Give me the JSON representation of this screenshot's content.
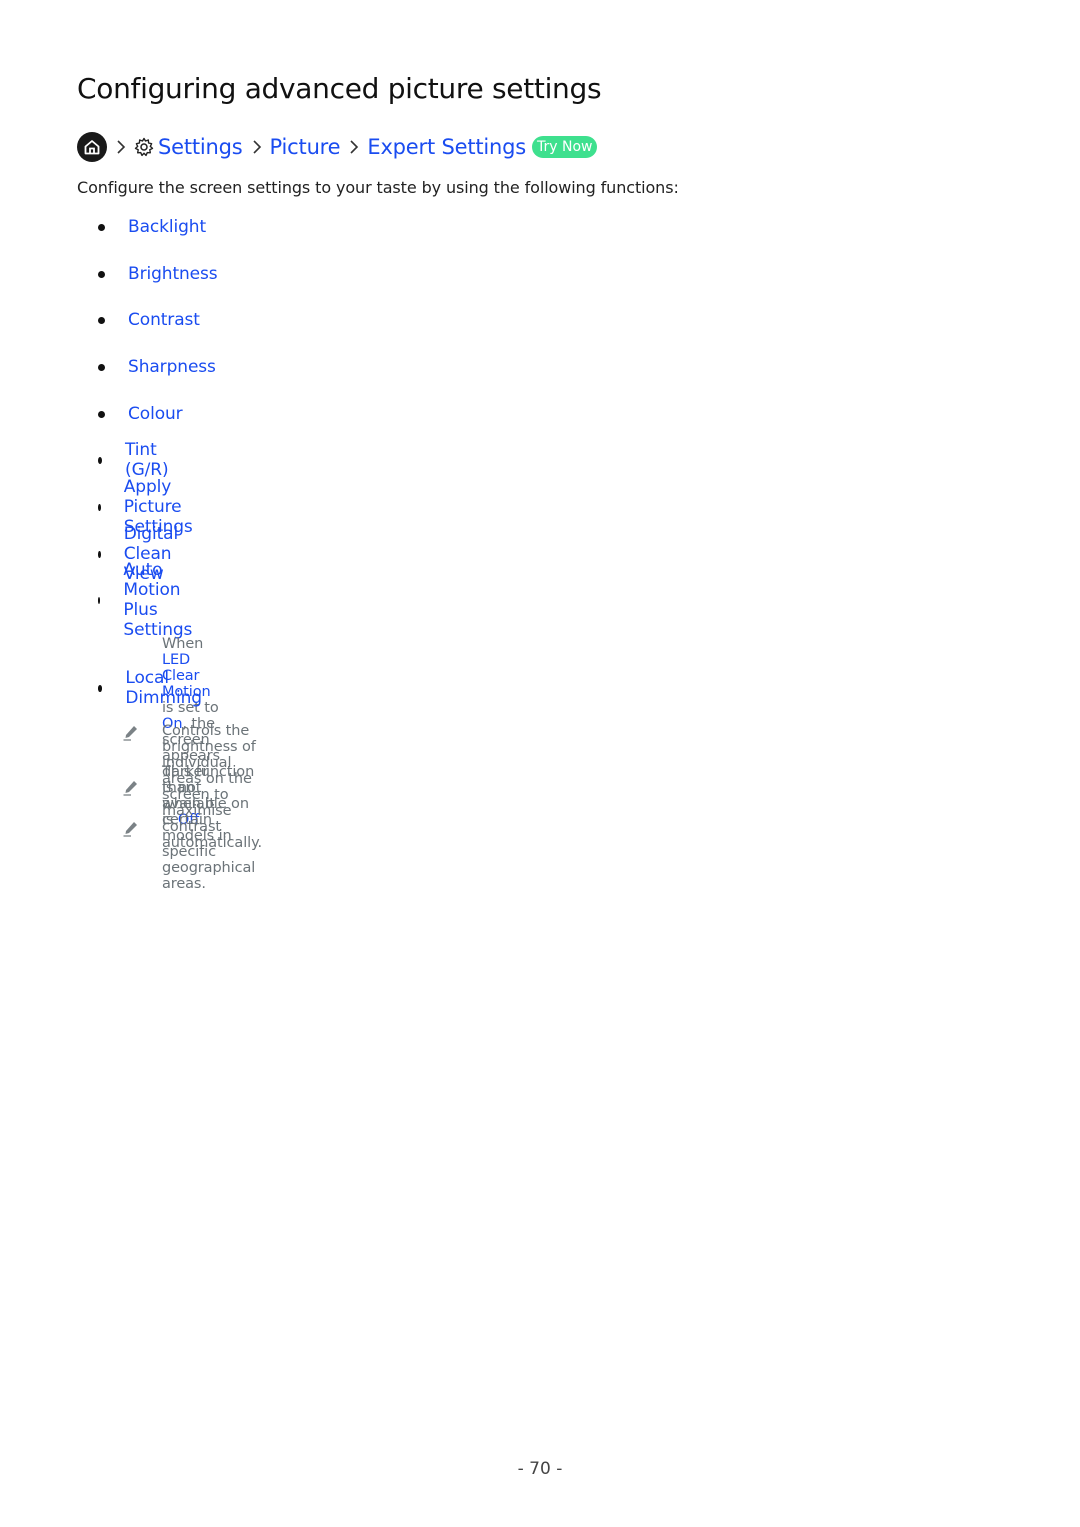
{
  "page": {
    "title": "Configuring advanced picture settings",
    "number": "- 70 -"
  },
  "breadcrumb": {
    "home_icon": "home-icon",
    "settings_icon": "gear-icon",
    "items": [
      "Settings",
      "Picture",
      "Expert Settings"
    ],
    "try_now": "Try Now"
  },
  "intro": "Configure the screen settings to your taste by using the following functions:",
  "items": [
    {
      "label": "Backlight"
    },
    {
      "label": "Brightness"
    },
    {
      "label": "Contrast"
    },
    {
      "label": "Sharpness"
    },
    {
      "label": "Colour"
    },
    {
      "label": "Tint (G/R)"
    },
    {
      "label": "Apply Picture Settings"
    },
    {
      "label": "Digital Clean View"
    },
    {
      "label": "Auto Motion Plus Settings"
    },
    {
      "label": "Local Dimming"
    }
  ],
  "notes": {
    "motion": {
      "p1": "When ",
      "h1": "LED Clear Motion",
      "p2": " is set to ",
      "h2": "On",
      "p3": ", the screen appears darker than when it is ",
      "h3": "Off",
      "p4": "."
    },
    "dimming": [
      "Controls the brightness of individual areas on the screen to maximise contrast automatically.",
      "This function is not available on certain models in specific geographical areas."
    ]
  },
  "colors": {
    "link": "#1a4cf0",
    "try_now_bg": "#3ee08e",
    "note_text": "#6b7378"
  }
}
